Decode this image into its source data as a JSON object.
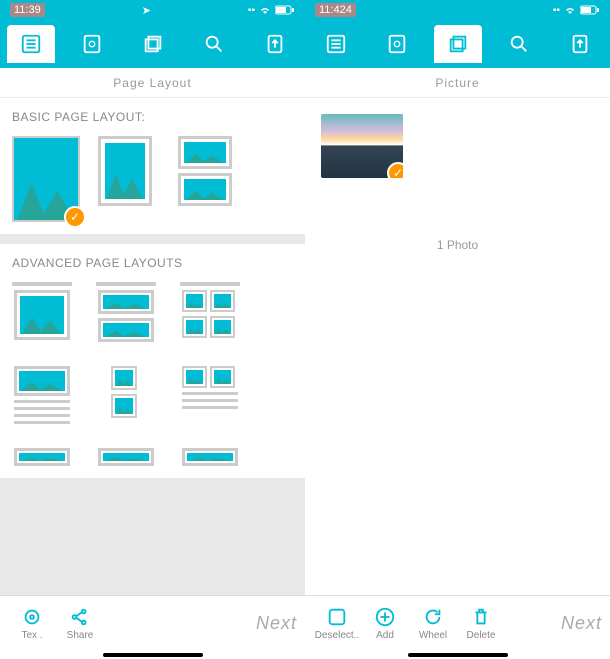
{
  "left": {
    "status": {
      "time": "11:39",
      "nav_icon": "location-arrow-icon"
    },
    "tabs": {
      "active": 0
    },
    "subheader": "Page Layout",
    "sections": {
      "basic": {
        "title": "BASIC PAGE LAYOUT:",
        "selected": 0
      },
      "advanced": {
        "title": "ADVANCED PAGE LAYOUTS"
      }
    },
    "bottom": {
      "tex": "Tex .",
      "share": "Share",
      "next": "Next"
    }
  },
  "right": {
    "status": {
      "time": "11:424"
    },
    "tabs": {
      "active": 2
    },
    "subheader": "Picture",
    "photos": {
      "count_label": "1 Photo",
      "selected": true
    },
    "bottom": {
      "deselect": "Deselect..",
      "add": "Add",
      "wheel": "Wheel",
      "delete": "Delete",
      "next": "Next"
    }
  },
  "colors": {
    "accent": "#00bcd4",
    "check": "#ff9800"
  }
}
